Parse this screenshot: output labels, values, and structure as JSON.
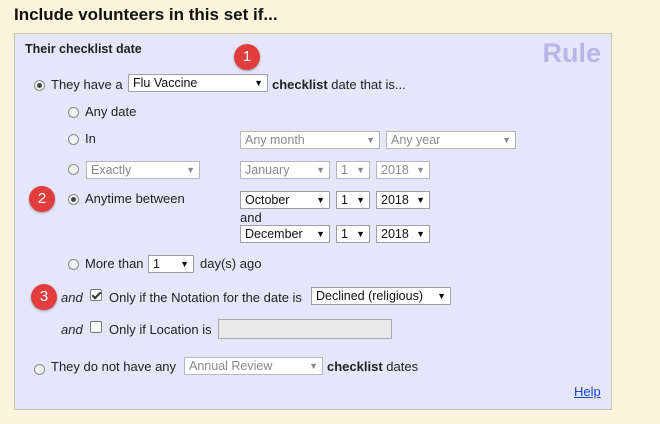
{
  "heading": "Include volunteers in this set if...",
  "panel": {
    "title": "Their checklist date",
    "rule_word": "Rule",
    "help_link": "Help"
  },
  "badges": [
    "1",
    "2",
    "3"
  ],
  "have": {
    "prefix": "They have a",
    "checklist": "Flu Vaccine",
    "suffix_bold": "checklist",
    "suffix_rest": "date that is..."
  },
  "any_date": {
    "label": "Any date"
  },
  "in": {
    "label": "In",
    "month": "Any month",
    "year": "Any year"
  },
  "exactly": {
    "type": "Exactly",
    "month": "January",
    "day": "1",
    "year": "2018"
  },
  "between": {
    "label": "Anytime between",
    "start": {
      "month": "October",
      "day": "1",
      "year": "2018"
    },
    "and_label": "and",
    "end": {
      "month": "December",
      "day": "1",
      "year": "2018"
    }
  },
  "more_than": {
    "label": "More than",
    "value": "1",
    "suffix": "day(s) ago"
  },
  "notation": {
    "and": "and",
    "label": "Only if the Notation for the date is",
    "value": "Declined (religious)",
    "checked": true
  },
  "location": {
    "and": "and",
    "label": "Only if Location is",
    "value": "",
    "checked": false
  },
  "not_have": {
    "prefix": "They do not have any",
    "checklist": "Annual Review",
    "suffix_bold": "checklist",
    "suffix_rest": "dates"
  },
  "arrow_glyph": "▼",
  "colors": {
    "panel_bg": "#e6e6fa",
    "page_bg": "#fdf4dc",
    "badge": "#e23d3d",
    "link": "#1a44cc"
  }
}
